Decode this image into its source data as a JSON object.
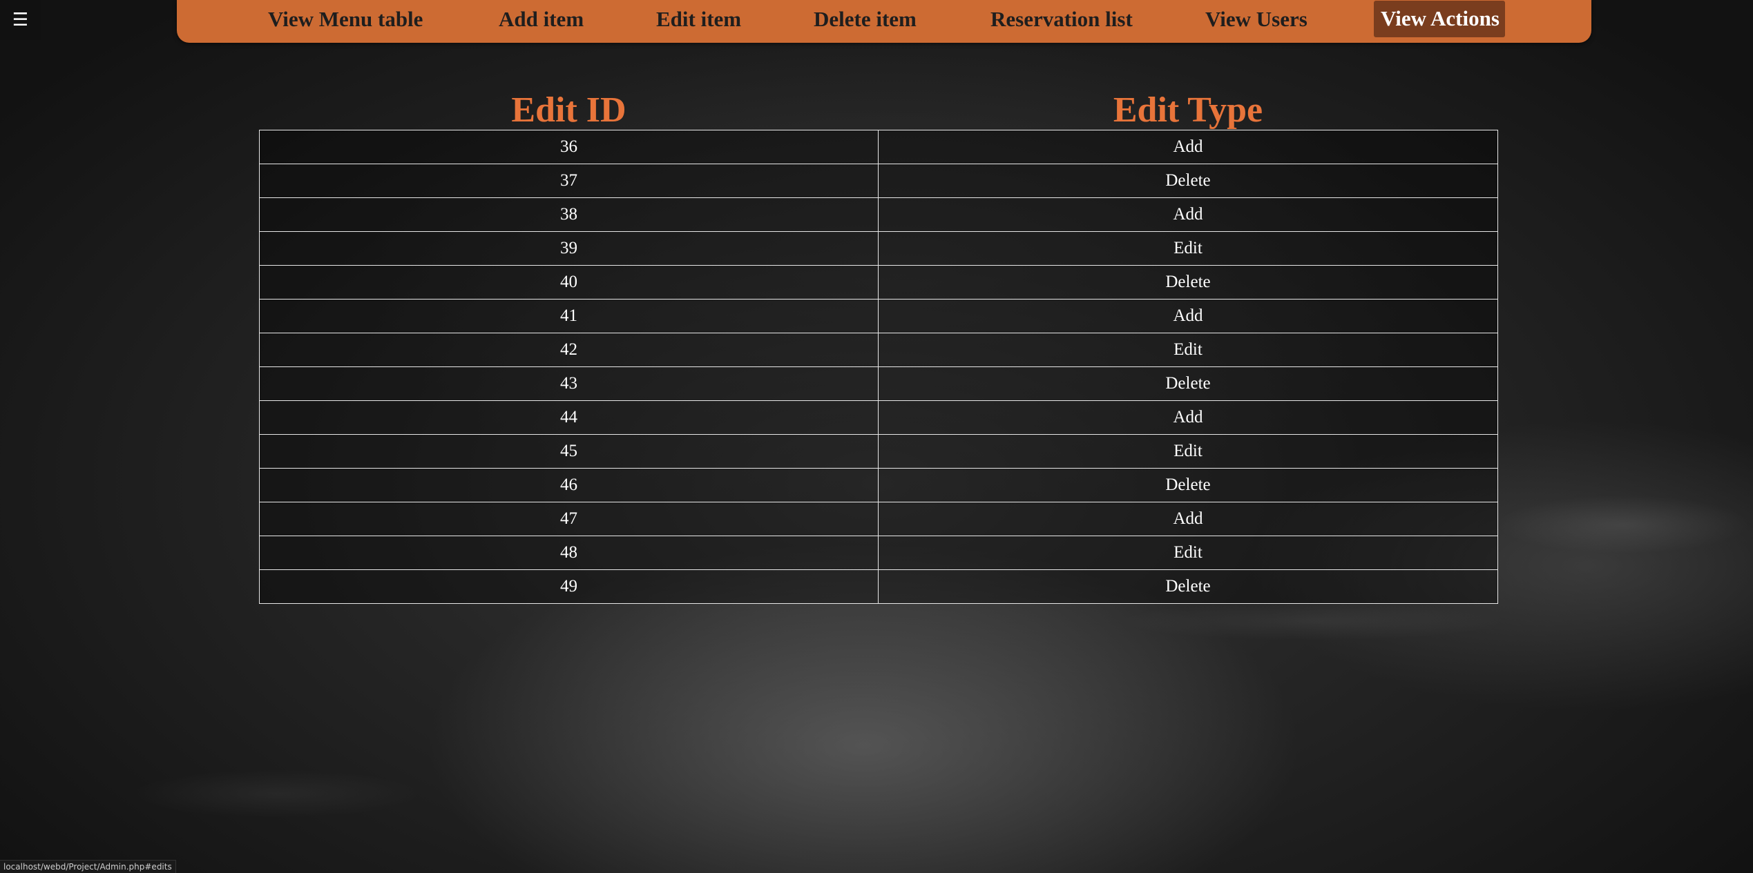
{
  "menu_toggle": {
    "icon": "☰"
  },
  "nav": {
    "items": [
      {
        "label": "View Menu table"
      },
      {
        "label": "Add item"
      },
      {
        "label": "Edit item"
      },
      {
        "label": "Delete item"
      },
      {
        "label": "Reservation list"
      },
      {
        "label": "View Users"
      },
      {
        "label": "View Actions",
        "active": true
      }
    ]
  },
  "table": {
    "headers": [
      "Edit ID",
      "Edit Type"
    ],
    "rows": [
      {
        "id": "36",
        "type": "Add"
      },
      {
        "id": "37",
        "type": "Delete"
      },
      {
        "id": "38",
        "type": "Add"
      },
      {
        "id": "39",
        "type": "Edit"
      },
      {
        "id": "40",
        "type": "Delete"
      },
      {
        "id": "41",
        "type": "Add"
      },
      {
        "id": "42",
        "type": "Edit"
      },
      {
        "id": "43",
        "type": "Delete"
      },
      {
        "id": "44",
        "type": "Add"
      },
      {
        "id": "45",
        "type": "Edit"
      },
      {
        "id": "46",
        "type": "Delete"
      },
      {
        "id": "47",
        "type": "Add"
      },
      {
        "id": "48",
        "type": "Edit"
      },
      {
        "id": "49",
        "type": "Delete"
      }
    ]
  },
  "status_bar": {
    "url": "localhost/webd/Project/Admin.php#edits"
  },
  "colors": {
    "nav_background": "#cd6b33",
    "nav_active": "#7a3d1e",
    "header_text": "#e8743a",
    "board_background": "#262626"
  }
}
